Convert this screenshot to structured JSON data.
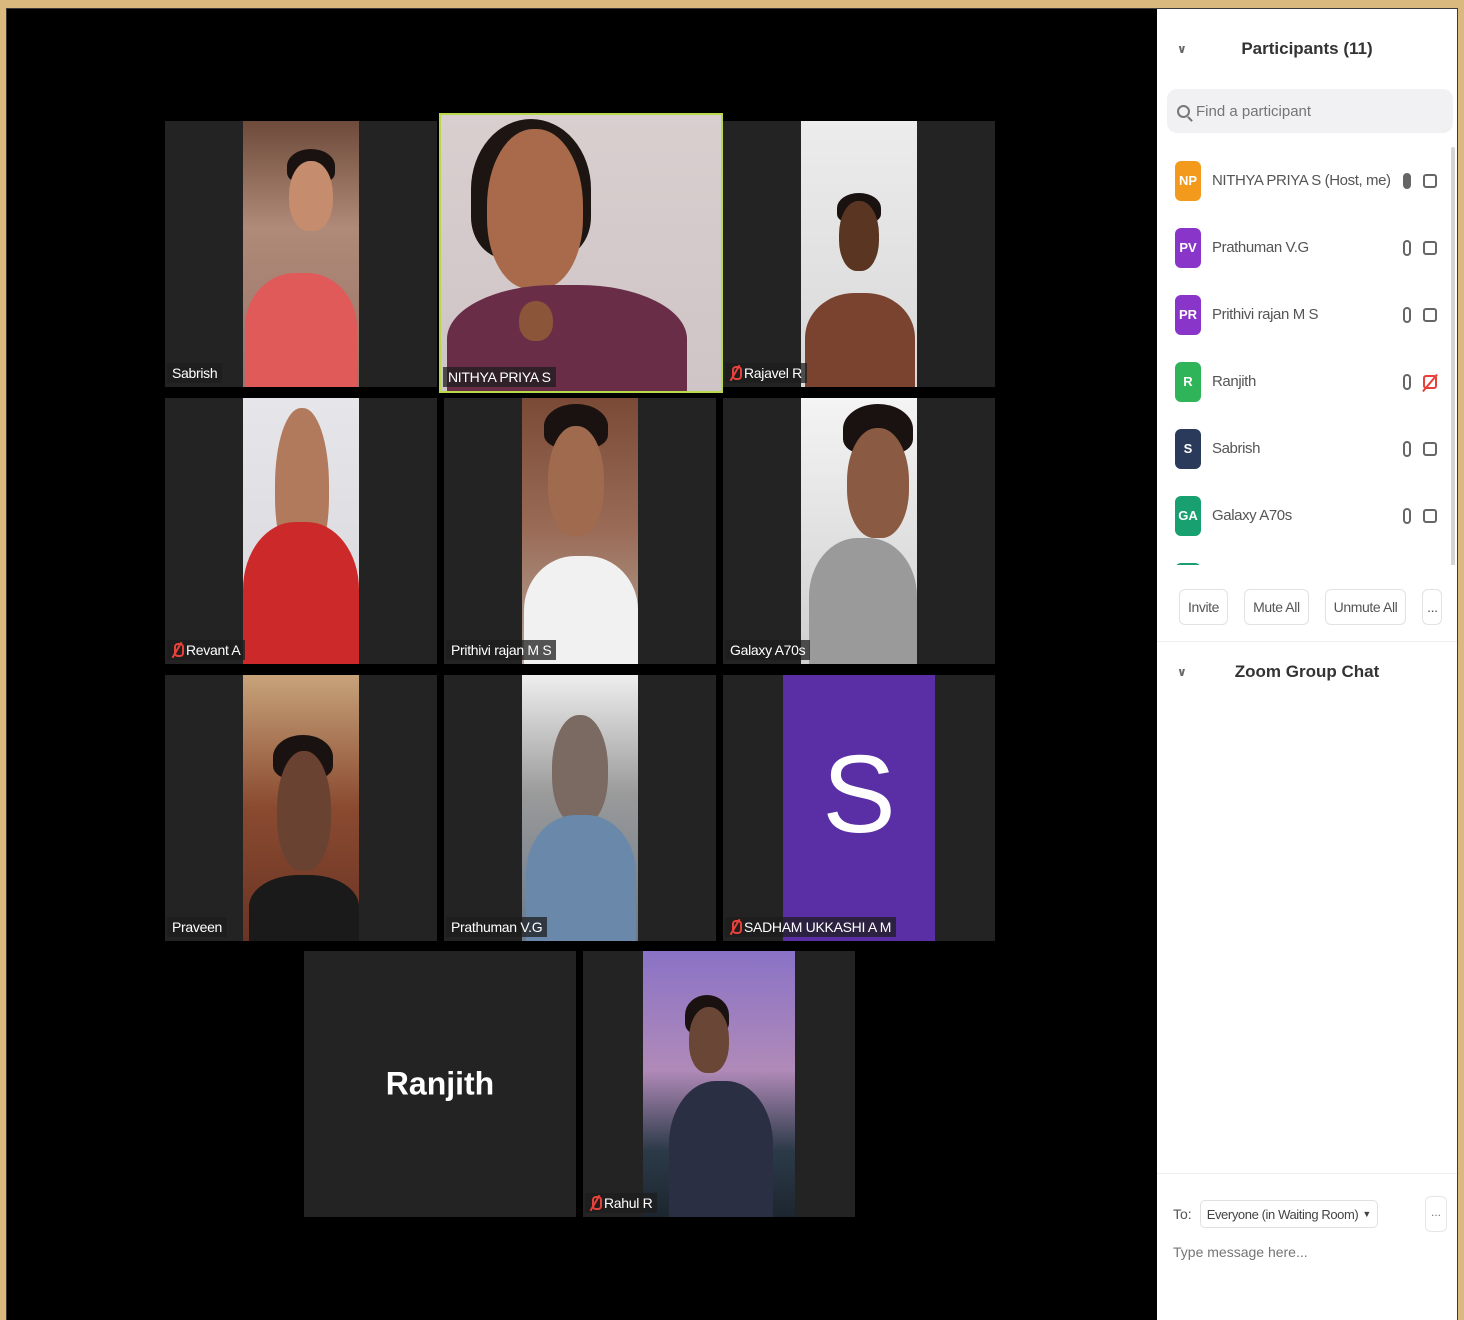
{
  "participants_panel": {
    "title": "Participants (11)",
    "search_placeholder": "Find a participant",
    "participants": [
      {
        "initials": "NP",
        "name": "NITHYA PRIYA S (Host, me)",
        "color": "#f39a1c",
        "mic": "on",
        "video": "on"
      },
      {
        "initials": "PV",
        "name": "Prathuman V.G",
        "color": "#8a35c9",
        "mic": "on",
        "video": "on"
      },
      {
        "initials": "PR",
        "name": "Prithivi rajan M S",
        "color": "#8a35c9",
        "mic": "on",
        "video": "on"
      },
      {
        "initials": "R",
        "name": "Ranjith",
        "color": "#2fb45a",
        "mic": "on",
        "video": "off"
      },
      {
        "initials": "S",
        "name": "Sabrish",
        "color": "#2a3a5a",
        "mic": "on",
        "video": "on"
      },
      {
        "initials": "GA",
        "name": "Galaxy A70s",
        "color": "#18a070",
        "mic": "on",
        "video": "on"
      }
    ],
    "actions": {
      "invite": "Invite",
      "mute_all": "Mute All",
      "unmute_all": "Unmute All",
      "more": "..."
    }
  },
  "chat_panel": {
    "title": "Zoom Group Chat",
    "to_label": "To:",
    "recipient": "Everyone (in Waiting Room)",
    "message_placeholder": "Type message here...",
    "more": "..."
  },
  "gallery": {
    "tiles": [
      {
        "name": "Sabrish",
        "muted": false,
        "active": false
      },
      {
        "name": "NITHYA PRIYA S",
        "muted": false,
        "active": true
      },
      {
        "name": "Rajavel R",
        "muted": true,
        "active": false
      },
      {
        "name": "Revant A",
        "muted": true,
        "active": false
      },
      {
        "name": "Prithivi rajan M S",
        "muted": false,
        "active": false
      },
      {
        "name": "Galaxy A70s",
        "muted": false,
        "active": false
      },
      {
        "name": "Praveen",
        "muted": false,
        "active": false
      },
      {
        "name": "Prathuman V.G",
        "muted": false,
        "active": false
      },
      {
        "name": "SADHAM UKKASHI A M",
        "muted": true,
        "active": false,
        "avatar_letter": "S"
      },
      {
        "name": "Ranjith",
        "video_off": true
      },
      {
        "name": "Rahul R",
        "muted": true,
        "active": false
      }
    ]
  }
}
